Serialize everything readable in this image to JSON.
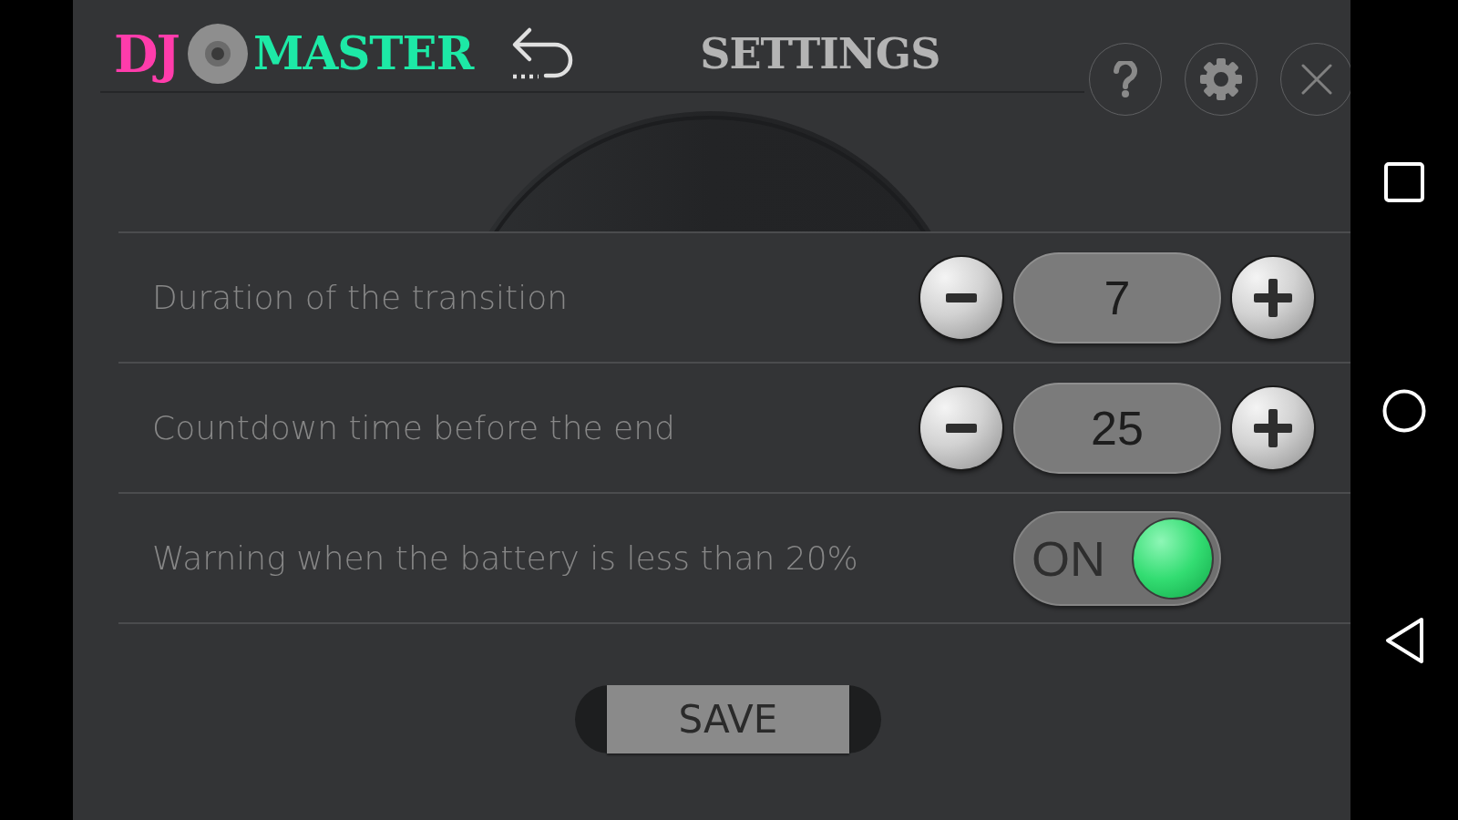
{
  "header": {
    "logo": {
      "left_text": "DJ",
      "right_text": "MASTER"
    },
    "title": "SETTINGS"
  },
  "settings": [
    {
      "kind": "stepper",
      "label": "Duration of the transition",
      "value": "7"
    },
    {
      "kind": "stepper",
      "label": "Countdown time before the end",
      "value": "25"
    },
    {
      "kind": "toggle",
      "label": "Warning when the battery is less than 20%",
      "on": true,
      "state_text": "ON"
    }
  ],
  "save_button": {
    "label": "SAVE"
  }
}
